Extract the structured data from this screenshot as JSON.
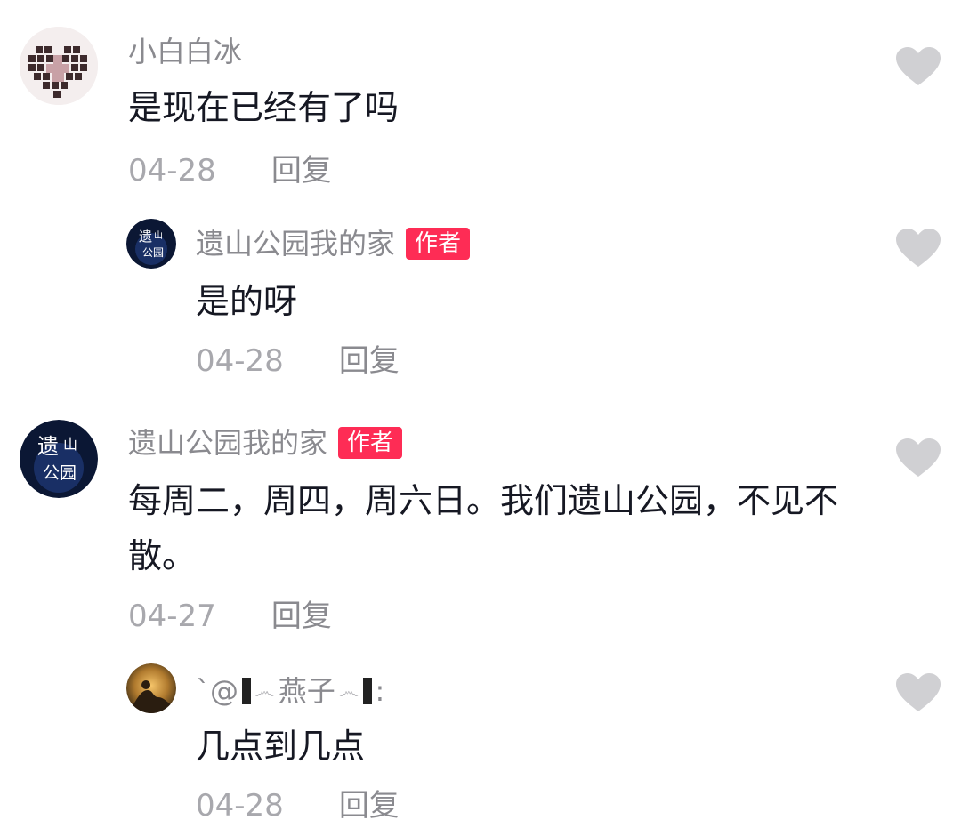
{
  "comments": [
    {
      "username": "小白白冰",
      "text": "是现在已经有了吗",
      "date": "04-28",
      "reply_label": "回复",
      "avatar": "heart-mosaic-avatar"
    },
    {
      "username": "遗山公园我的家",
      "badge": "作者",
      "text": "是的呀",
      "date": "04-28",
      "reply_label": "回复",
      "avatar": "park-logo-avatar"
    },
    {
      "username": "遗山公园我的家",
      "badge": "作者",
      "text": "每周二，周四，周六日。我们遗山公园，不见不散。",
      "date": "04-27",
      "reply_label": "回复",
      "avatar": "park-logo-avatar"
    },
    {
      "username_prefix": "`@",
      "username_main": "燕子",
      "username_suffix": ":",
      "text": "几点到几点",
      "date": "04-28",
      "reply_label": "回复",
      "avatar": "sunset-silhouette-avatar"
    }
  ],
  "colors": {
    "badge": "#fe2c55",
    "like_icon": "#d0d0d3",
    "username": "#8a8a8f",
    "meta": "#a8a8ad",
    "text": "#161823"
  },
  "icons": {
    "like": "heart-icon"
  }
}
